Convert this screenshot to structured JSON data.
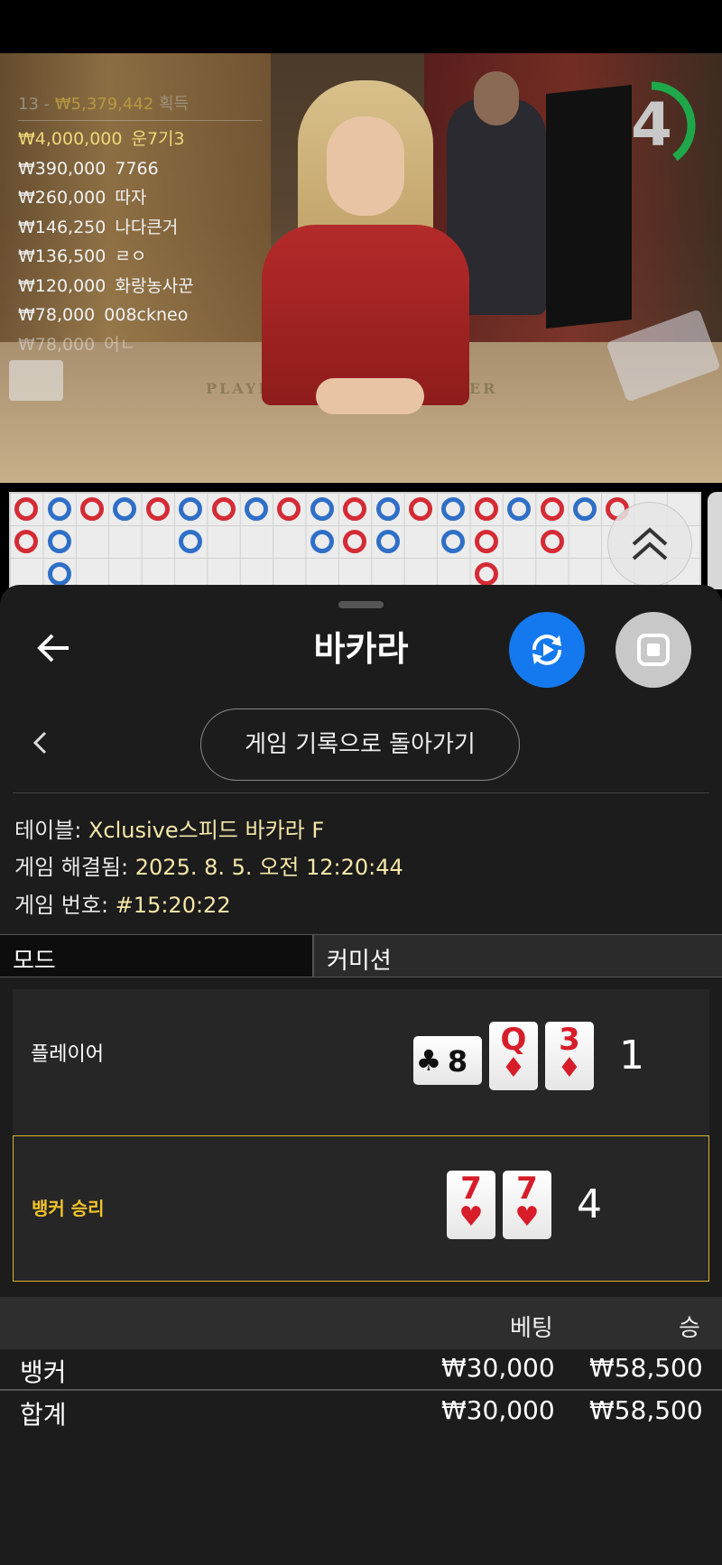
{
  "video": {
    "winners_header_count": "13",
    "winners_header_amount": "₩5,379,442",
    "winners_header_label": "획득",
    "winners": [
      {
        "amount": "₩4,000,000",
        "name": "운7기3"
      },
      {
        "amount": "₩390,000",
        "name": "7766"
      },
      {
        "amount": "₩260,000",
        "name": "따자"
      },
      {
        "amount": "₩146,250",
        "name": "나다큰거"
      },
      {
        "amount": "₩136,500",
        "name": "ㄹㅇ"
      },
      {
        "amount": "₩120,000",
        "name": "화랑농사꾼"
      },
      {
        "amount": "₩78,000",
        "name": "008ckneo"
      },
      {
        "amount": "₩78,000",
        "name": "어ㄴ"
      }
    ],
    "table_labels": {
      "player": "PLAYER",
      "banker": "ANKER"
    },
    "countdown": "4",
    "countdown_fraction": 0.4,
    "timer_color": "#1fa84a"
  },
  "roadmap": {
    "banker_color": "#d42b35",
    "player_color": "#2f6fc7",
    "tie_color": "#1f8a3a",
    "columns": [
      [
        "B",
        "B"
      ],
      [
        "P",
        "P",
        "P"
      ],
      [
        "B"
      ],
      [
        "P"
      ],
      [
        "B"
      ],
      [
        "P",
        "P"
      ],
      [
        "B"
      ],
      [
        "P"
      ],
      [
        "B"
      ],
      [
        "P",
        "P"
      ],
      [
        "B",
        "B"
      ],
      [
        "P",
        "P"
      ],
      [
        "B"
      ],
      [
        "P",
        "P"
      ],
      [
        "B",
        "B",
        "B"
      ],
      [
        "P"
      ],
      [
        "B",
        "B"
      ],
      [
        "P"
      ],
      [
        "B"
      ]
    ]
  },
  "header": {
    "title": "바카라",
    "back_icon": "arrow-left-icon",
    "replay_icon": "video-replay-icon",
    "stop_icon": "stop-square-icon"
  },
  "history_button": "게임 기록으로 돌아가기",
  "details": {
    "table_label": "테이블:",
    "table_value": "Xclusive스피드 바카라 F",
    "resolved_label": "게임 해결됨:",
    "resolved_value": "2025. 8. 5. 오전 12:20:44",
    "game_no_label": "게임 번호:",
    "game_no_value": "#15:20:22"
  },
  "mode_bar": {
    "mode": "모드",
    "commission": "커미션"
  },
  "outcomes": {
    "player": {
      "label": "플레이어",
      "score": "1",
      "cards": [
        {
          "rank": "8",
          "suit": "♣",
          "color": "black",
          "sideways": true
        },
        {
          "rank": "Q",
          "suit": "♦",
          "color": "red"
        },
        {
          "rank": "3",
          "suit": "♦",
          "color": "red"
        }
      ]
    },
    "banker": {
      "label": "뱅커 승리",
      "score": "4",
      "cards": [
        {
          "rank": "7",
          "suit": "♥",
          "color": "red"
        },
        {
          "rank": "7",
          "suit": "♥",
          "color": "red"
        }
      ]
    }
  },
  "bets_table": {
    "col_bet": "베팅",
    "col_win": "승",
    "rows": [
      {
        "name": "뱅커",
        "bet": "₩30,000",
        "win": "₩58,500"
      }
    ],
    "total": {
      "name": "합계",
      "bet": "₩30,000",
      "win": "₩58,500"
    }
  }
}
